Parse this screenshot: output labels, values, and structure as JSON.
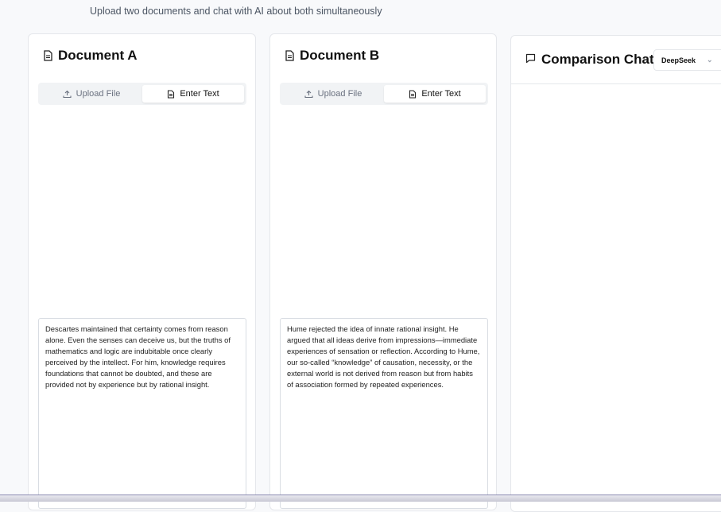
{
  "header": {
    "subtitle": "Upload two documents and chat with AI about both simultaneously"
  },
  "doc_a": {
    "title": "Document A",
    "tabs": {
      "upload": "Upload File",
      "text": "Enter Text"
    },
    "active_tab": "Enter Text",
    "text": "Descartes maintained that certainty comes from reason alone. Even the senses can deceive us, but the truths of mathematics and logic are indubitable once clearly perceived by the intellect. For him, knowledge requires foundations that cannot be doubted, and these are provided not by experience but by rational insight."
  },
  "doc_b": {
    "title": "Document B",
    "tabs": {
      "upload": "Upload File",
      "text": "Enter Text"
    },
    "active_tab": "Enter Text",
    "text": "Hume rejected the idea of innate rational insight. He argued that all ideas derive from impressions—immediate experiences of sensation or reflection. According to Hume, our so-called “knowledge” of causation, necessity, or the external world is not derived from reason but from habits of association formed by repeated experiences."
  },
  "chat": {
    "title": "Comparison Chat",
    "model": "DeepSeek"
  },
  "icons": {
    "doc_title": "document-icon",
    "upload": "upload-icon",
    "text": "document-icon",
    "chat": "message-square-icon",
    "select": "chevron-down-icon"
  }
}
